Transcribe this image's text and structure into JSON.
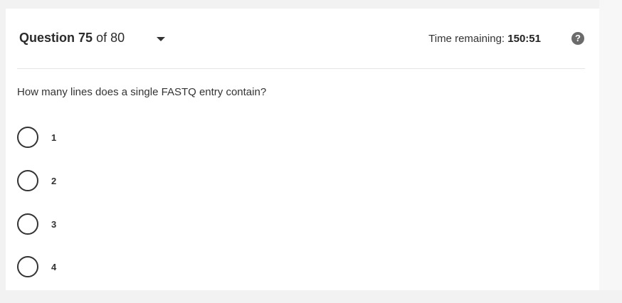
{
  "header": {
    "question_word": "Question",
    "question_number": "75",
    "question_of": "of 80",
    "timer_label": "Time remaining:",
    "timer_value": "150:51",
    "help_symbol": "?"
  },
  "question": {
    "text": "How many lines does a single FASTQ entry contain?",
    "options": [
      {
        "label": "1",
        "selected": false
      },
      {
        "label": "2",
        "selected": false
      },
      {
        "label": "3",
        "selected": false
      },
      {
        "label": "4",
        "selected": false
      }
    ]
  },
  "icons": {
    "dropdown": "caret-down-icon",
    "help": "help-circle-icon"
  },
  "colors": {
    "background": "#f2f2f2",
    "card": "#ffffff",
    "text": "#333333",
    "help_icon": "#6b6b6b"
  }
}
